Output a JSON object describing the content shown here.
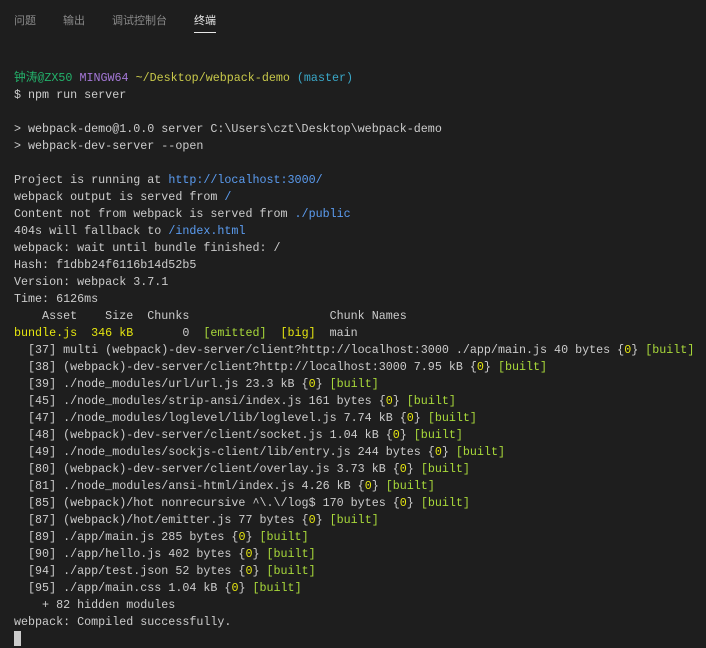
{
  "tabs": [
    "问题",
    "输出",
    "调试控制台",
    "终端"
  ],
  "active_tab": 3,
  "lines": [
    [],
    [
      [
        "钟涛@ZX50 ",
        "g"
      ],
      [
        "MINGW64 ",
        "p"
      ],
      [
        "~/Desktop/webpack-demo ",
        "y"
      ],
      [
        "(master)",
        "c"
      ]
    ],
    [
      [
        "$ npm run server",
        ""
      ]
    ],
    [],
    [
      [
        "> webpack-demo@1.0.0 server C:\\Users\\czt\\Desktop\\webpack-demo",
        ""
      ]
    ],
    [
      [
        "> webpack-dev-server --open",
        ""
      ]
    ],
    [],
    [
      [
        "Project is running at ",
        ""
      ],
      [
        "http://localhost:3000/",
        "b"
      ]
    ],
    [
      [
        "webpack output is served from ",
        ""
      ],
      [
        "/",
        "b"
      ]
    ],
    [
      [
        "Content not from webpack is served from ",
        ""
      ],
      [
        "./public",
        "b"
      ]
    ],
    [
      [
        "404s will fallback to ",
        ""
      ],
      [
        "/index.html",
        "b"
      ]
    ],
    [
      [
        "webpack: wait until bundle finished: /",
        ""
      ]
    ],
    [
      [
        "Hash: f1dbb24f6116b14d52b5",
        ""
      ]
    ],
    [
      [
        "Version: webpack 3.7.1",
        ""
      ]
    ],
    [
      [
        "Time: 6126ms",
        ""
      ]
    ],
    [
      [
        "    Asset    Size  Chunks                    Chunk Names",
        ""
      ]
    ],
    [
      [
        "bundle.js  346 kB",
        "yb"
      ],
      [
        "       0  ",
        ""
      ],
      [
        "[emitted]",
        "lg"
      ],
      [
        "  ",
        ""
      ],
      [
        "[big]",
        "yb"
      ],
      [
        "  main",
        ""
      ]
    ],
    [
      [
        "  [37] multi (webpack)-dev-server/client?http://localhost:3000 ./app/main.js 40 bytes {",
        ""
      ],
      [
        "0",
        "z"
      ],
      [
        "} ",
        ""
      ],
      [
        "[built]",
        "lg"
      ]
    ],
    [
      [
        "  [38] (webpack)-dev-server/client?http://localhost:3000 7.95 kB {",
        ""
      ],
      [
        "0",
        "z"
      ],
      [
        "} ",
        ""
      ],
      [
        "[built]",
        "lg"
      ]
    ],
    [
      [
        "  [39] ./node_modules/url/url.js 23.3 kB {",
        ""
      ],
      [
        "0",
        "z"
      ],
      [
        "} ",
        ""
      ],
      [
        "[built]",
        "lg"
      ]
    ],
    [
      [
        "  [45] ./node_modules/strip-ansi/index.js 161 bytes {",
        ""
      ],
      [
        "0",
        "z"
      ],
      [
        "} ",
        ""
      ],
      [
        "[built]",
        "lg"
      ]
    ],
    [
      [
        "  [47] ./node_modules/loglevel/lib/loglevel.js 7.74 kB {",
        ""
      ],
      [
        "0",
        "z"
      ],
      [
        "} ",
        ""
      ],
      [
        "[built]",
        "lg"
      ]
    ],
    [
      [
        "  [48] (webpack)-dev-server/client/socket.js 1.04 kB {",
        ""
      ],
      [
        "0",
        "z"
      ],
      [
        "} ",
        ""
      ],
      [
        "[built]",
        "lg"
      ]
    ],
    [
      [
        "  [49] ./node_modules/sockjs-client/lib/entry.js 244 bytes {",
        ""
      ],
      [
        "0",
        "z"
      ],
      [
        "} ",
        ""
      ],
      [
        "[built]",
        "lg"
      ]
    ],
    [
      [
        "  [80] (webpack)-dev-server/client/overlay.js 3.73 kB {",
        ""
      ],
      [
        "0",
        "z"
      ],
      [
        "} ",
        ""
      ],
      [
        "[built]",
        "lg"
      ]
    ],
    [
      [
        "  [81] ./node_modules/ansi-html/index.js 4.26 kB {",
        ""
      ],
      [
        "0",
        "z"
      ],
      [
        "} ",
        ""
      ],
      [
        "[built]",
        "lg"
      ]
    ],
    [
      [
        "  [85] (webpack)/hot nonrecursive ^\\.\\/log$ 170 bytes {",
        ""
      ],
      [
        "0",
        "z"
      ],
      [
        "} ",
        ""
      ],
      [
        "[built]",
        "lg"
      ]
    ],
    [
      [
        "  [87] (webpack)/hot/emitter.js 77 bytes {",
        ""
      ],
      [
        "0",
        "z"
      ],
      [
        "} ",
        ""
      ],
      [
        "[built]",
        "lg"
      ]
    ],
    [
      [
        "  [89] ./app/main.js 285 bytes {",
        ""
      ],
      [
        "0",
        "z"
      ],
      [
        "} ",
        ""
      ],
      [
        "[built]",
        "lg"
      ]
    ],
    [
      [
        "  [90] ./app/hello.js 402 bytes {",
        ""
      ],
      [
        "0",
        "z"
      ],
      [
        "} ",
        ""
      ],
      [
        "[built]",
        "lg"
      ]
    ],
    [
      [
        "  [94] ./app/test.json 52 bytes {",
        ""
      ],
      [
        "0",
        "z"
      ],
      [
        "} ",
        ""
      ],
      [
        "[built]",
        "lg"
      ]
    ],
    [
      [
        "  [95] ./app/main.css 1.04 kB {",
        ""
      ],
      [
        "0",
        "z"
      ],
      [
        "} ",
        ""
      ],
      [
        "[built]",
        "lg"
      ]
    ],
    [
      [
        "    + 82 hidden modules",
        ""
      ]
    ],
    [
      [
        "webpack: Compiled successfully.",
        ""
      ]
    ]
  ]
}
